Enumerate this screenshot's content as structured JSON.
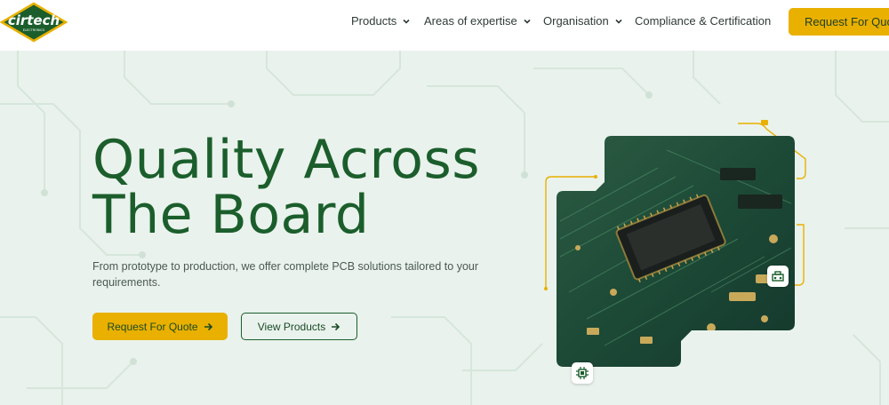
{
  "header": {
    "logo_alt": "cirtech electronics logo",
    "nav": [
      {
        "label": "Products"
      },
      {
        "label": "Areas of expertise"
      },
      {
        "label": "Organisation"
      },
      {
        "label": "Compliance & Certification"
      }
    ],
    "cta_label": "Request For Quote"
  },
  "hero": {
    "title_line1": "Quality Across",
    "title_line2": "The Board",
    "subtitle": "From prototype to production,  we offer complete PCB solutions tailored to your requirements.",
    "primary_button": "Request For Quote",
    "secondary_button": "View Products"
  },
  "colors": {
    "brand_green": "#1b5e2c",
    "accent_yellow": "#e9b000",
    "hero_bg": "#e9f2ec"
  },
  "icons": [
    "chevron-down-icon",
    "arrow-right-icon",
    "chip-icon",
    "machine-icon"
  ]
}
